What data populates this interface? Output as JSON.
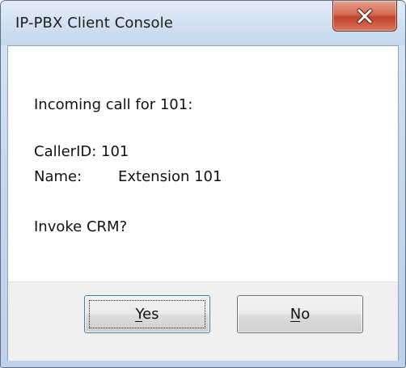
{
  "window": {
    "title": "IP-PBX Client Console"
  },
  "message": {
    "incoming": "Incoming call for 101:",
    "callerid": "CallerID: 101",
    "name_label": "Name:",
    "name_value": "Extension 101",
    "question": "Invoke CRM?"
  },
  "buttons": {
    "yes_label": "Yes",
    "no_label": "No"
  },
  "icons": {
    "close": "close-icon"
  },
  "colors": {
    "close_button": "#c8452c",
    "title_bar": "#c6d8ee",
    "default_button_border": "#3c7fb1"
  }
}
